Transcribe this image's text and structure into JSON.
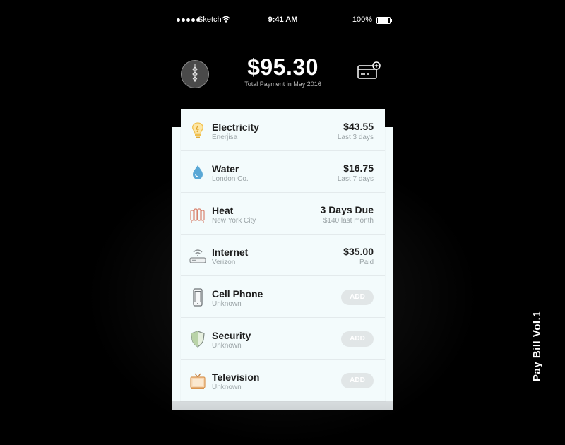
{
  "status_bar": {
    "carrier": "Sketch",
    "time": "9:41 AM",
    "battery": "100%"
  },
  "header": {
    "total": "$95.30",
    "subtitle": "Total Payment in May 2016",
    "logo_icon": "pendant-logo-icon",
    "add_card_icon": "credit-card-plus-icon"
  },
  "bills": [
    {
      "name": "Electricity",
      "provider": "Enerjisa",
      "amount": "$43.55",
      "note": "Last 3 days",
      "icon": "lightbulb-icon",
      "color": "#f2c14e"
    },
    {
      "name": "Water",
      "provider": "London Co.",
      "amount": "$16.75",
      "note": "Last 7 days",
      "icon": "water-drop-icon",
      "color": "#5aa8d6"
    },
    {
      "name": "Heat",
      "provider": "New York City",
      "amount": "3 Days Due",
      "note": "$140 last month",
      "icon": "radiator-icon",
      "color": "#d9836f"
    },
    {
      "name": "Internet",
      "provider": "Verizon",
      "amount": "$35.00",
      "note": "Paid",
      "icon": "router-icon",
      "color": "#8a8f92"
    }
  ],
  "unpaid": [
    {
      "name": "Cell Phone",
      "provider": "Unknown",
      "button": "ADD",
      "icon": "cell-phone-icon",
      "color": "#6d7376"
    },
    {
      "name": "Security",
      "provider": "Unknown",
      "button": "ADD",
      "icon": "shield-icon",
      "color": "#9fbf8f"
    },
    {
      "name": "Television",
      "provider": "Unknown",
      "button": "ADD",
      "icon": "television-icon",
      "color": "#e0a26b"
    }
  ],
  "caption": "Pay Bill Vol.1"
}
